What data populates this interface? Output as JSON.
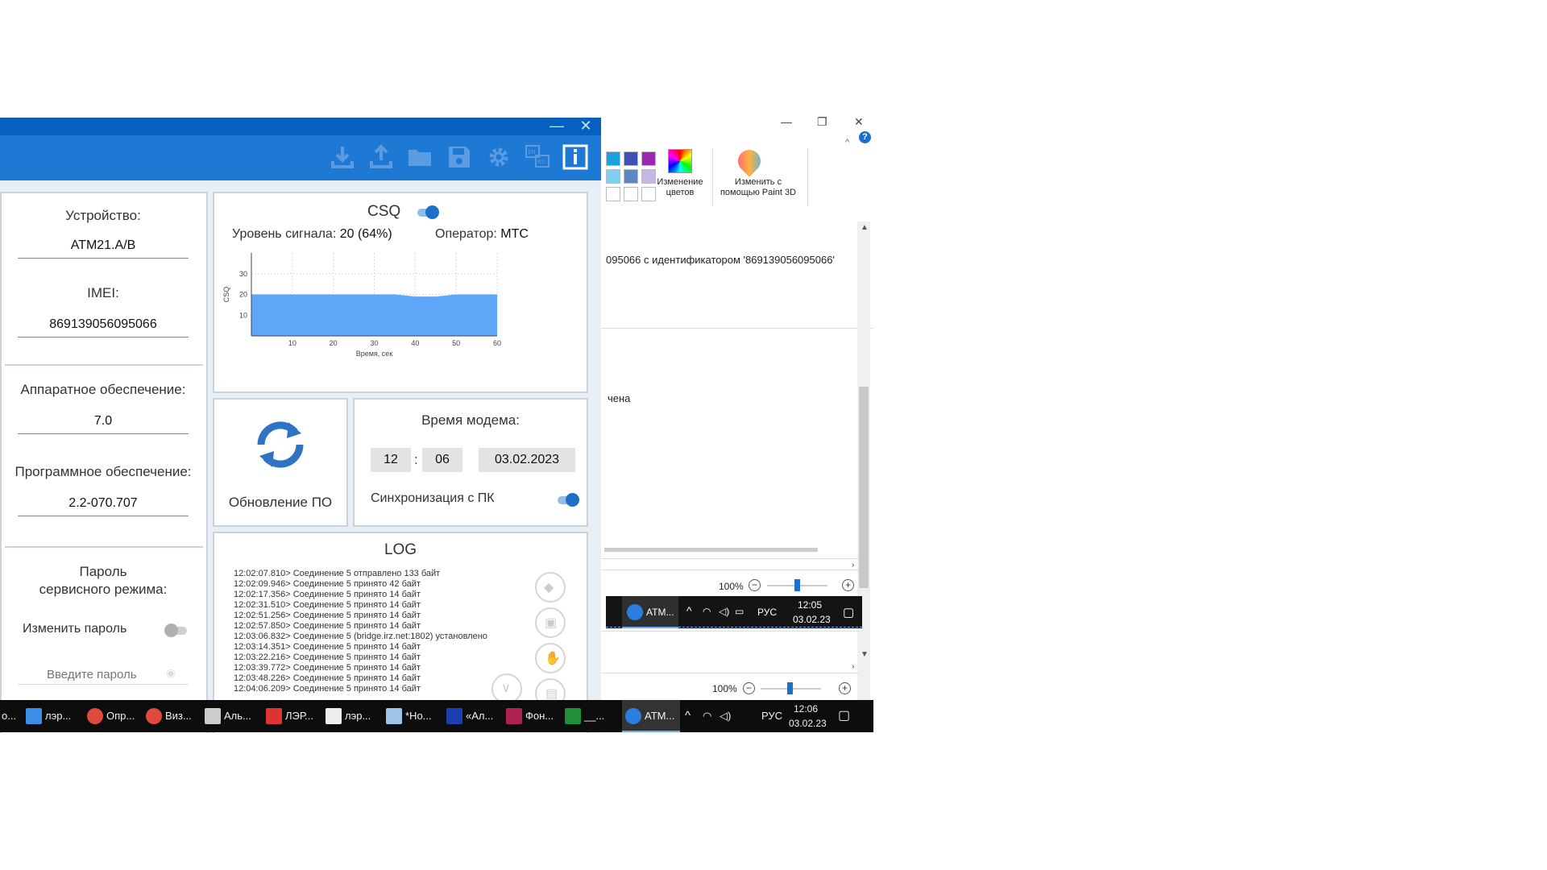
{
  "paint": {
    "minimize": "—",
    "restore": "❐",
    "close": "✕",
    "help": "?",
    "edit_colors_label": "Изменение цветов",
    "paint3d_label": "Изменить с помощью Paint 3D",
    "canvas_text_1": "095066 с идентификатором '869139056095066'",
    "canvas_text_2": "чена",
    "zoom_1": "100%",
    "zoom_2": "100%",
    "swatch_colors": [
      "#1ba1e2",
      "#3f51b5",
      "#9c27b0",
      "#7fd0f0",
      "#5b87c5",
      "#c5b6e6",
      "#ffffff",
      "#ffffff",
      "#ffffff"
    ]
  },
  "mini_taskbar": {
    "app_label": "ATM...",
    "lang": "РУС",
    "time": "12:05",
    "date": "03.02.23"
  },
  "window": {
    "minimize": "—",
    "close": "✕"
  },
  "toolbar": {
    "icons": [
      "download-icon",
      "upload-icon",
      "folder-icon",
      "save-icon",
      "gear-icon",
      "language-icon",
      "info-icon"
    ]
  },
  "device": {
    "device_label": "Устройство:",
    "device_value": "ATM21.A/B",
    "imei_label": "IMEI:",
    "imei_value": "869139056095066",
    "hw_label": "Аппаратное обеспечение:",
    "hw_value": "7.0",
    "sw_label": "Программное обеспечение:",
    "sw_value": "2.2-070.707",
    "password_label_1": "Пароль",
    "password_label_2": "сервисного режима:",
    "change_password_label": "Изменить пароль",
    "change_password_on": false,
    "password_placeholder": "Введите пароль"
  },
  "csq": {
    "title": "CSQ",
    "enabled": true,
    "signal_label": "Уровень сигнала:",
    "signal_value": "20 (64%)",
    "operator_label": "Оператор:",
    "operator_value": "MTC"
  },
  "chart_data": {
    "type": "area",
    "x": [
      0,
      10,
      20,
      30,
      35,
      40,
      45,
      50,
      55,
      60
    ],
    "series": [
      {
        "values": [
          20,
          20,
          20,
          20,
          20,
          19,
          19,
          20,
          20,
          20
        ]
      }
    ],
    "xlabel": "Время, сек",
    "ylabel": "CSQ",
    "xlim": [
      0,
      60
    ],
    "ylim": [
      0,
      40
    ],
    "xticks": [
      10,
      20,
      30,
      40,
      50,
      60
    ],
    "yticks": [
      10,
      20,
      30
    ],
    "grid": true,
    "color": "#5ea6f7"
  },
  "update": {
    "label": "Обновление ПО"
  },
  "modem_time": {
    "title": "Время модема:",
    "hours": "12",
    "separator": ":",
    "minutes": "06",
    "date": "03.02.2023",
    "sync_label": "Синхронизация с ПК",
    "sync_on": true
  },
  "log": {
    "title": "LOG",
    "lines": [
      "12:02:07.810> Соединение 5 отправлено 133 байт",
      "12:02:09.946> Соединение 5 принято 42 байт",
      "12:02:17.356> Соединение 5 принято 14 байт",
      "12:02:31.510> Соединение 5 принято 14 байт",
      "12:02:51.256> Соединение 5 принято 14 байт",
      "12:02:57.850> Соединение 5 принято 14 байт",
      "12:03:06.832> Соединение 5 (bridge.irz.net:1802) установлено",
      "12:03:14.351> Соединение 5 принято 14 байт",
      "12:03:22.216> Соединение 5 принято 14 байт",
      "12:03:39.772> Соединение 5 принято 14 байт",
      "12:03:48.226> Соединение 5 принято 14 байт",
      "12:04:06.209> Соединение 5 принято 14 байт"
    ]
  },
  "taskbar": {
    "items": [
      "о...",
      "лэр...",
      "Опр...",
      "Виз...",
      "Аль...",
      "ЛЭР...",
      "лэр...",
      "*Но...",
      "«Ал...",
      "Фон...",
      "__...",
      "ATM..."
    ],
    "lang": "РУС",
    "time": "12:06",
    "date": "03.02.23"
  }
}
